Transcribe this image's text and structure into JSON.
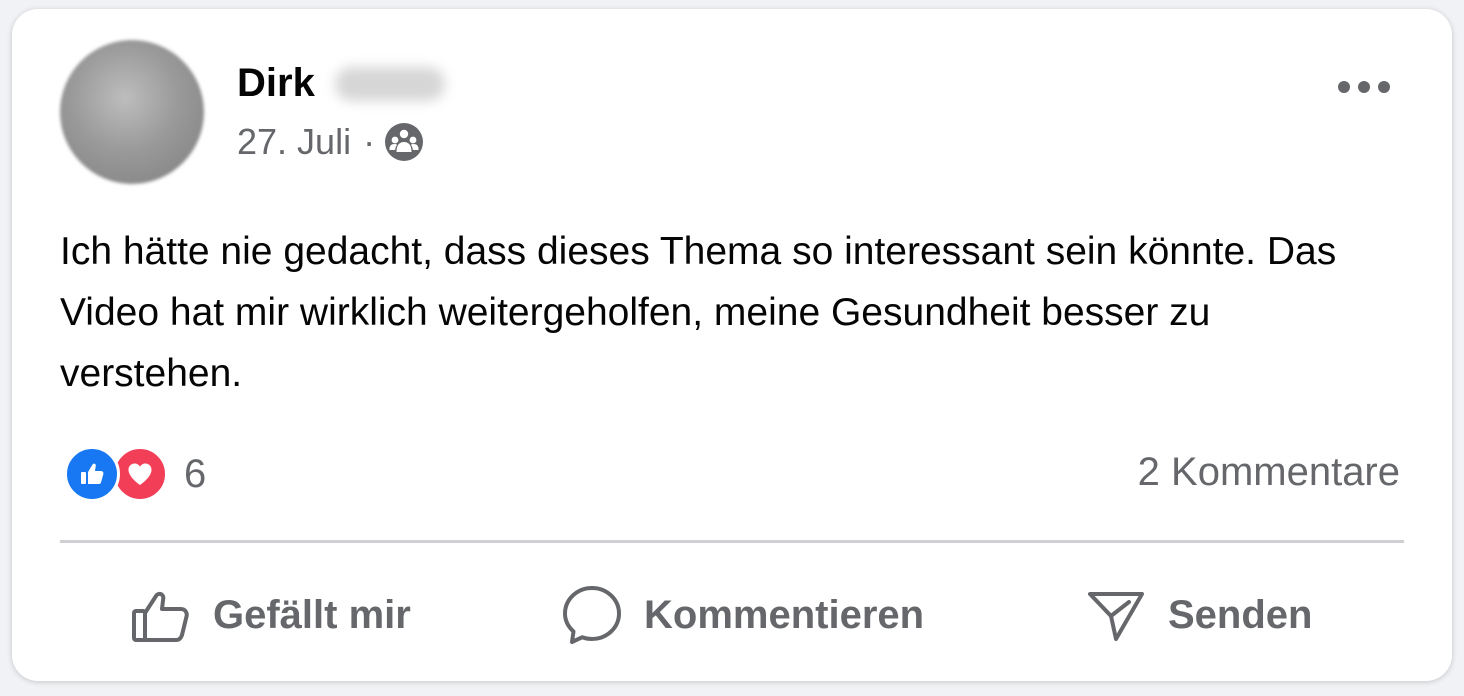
{
  "post": {
    "author_first_name": "Dirk",
    "date": "27. Juli",
    "separator": "·",
    "audience_icon": "friends-audience-icon",
    "more_icon": "more-horizontal-icon",
    "text": "Ich hätte nie gedacht, dass dieses Thema so interessant sein könnte. Das Video hat mir wirklich weitergeholfen, meine Gesundheit besser zu verstehen."
  },
  "reactions": {
    "types": [
      "like",
      "love"
    ],
    "count": "6",
    "like_color": "#1877f2",
    "love_color": "#f33e58"
  },
  "comments": {
    "count_label": "2 Kommentare"
  },
  "actions": {
    "like_label": "Gefällt mir",
    "comment_label": "Kommentieren",
    "send_label": "Senden"
  }
}
